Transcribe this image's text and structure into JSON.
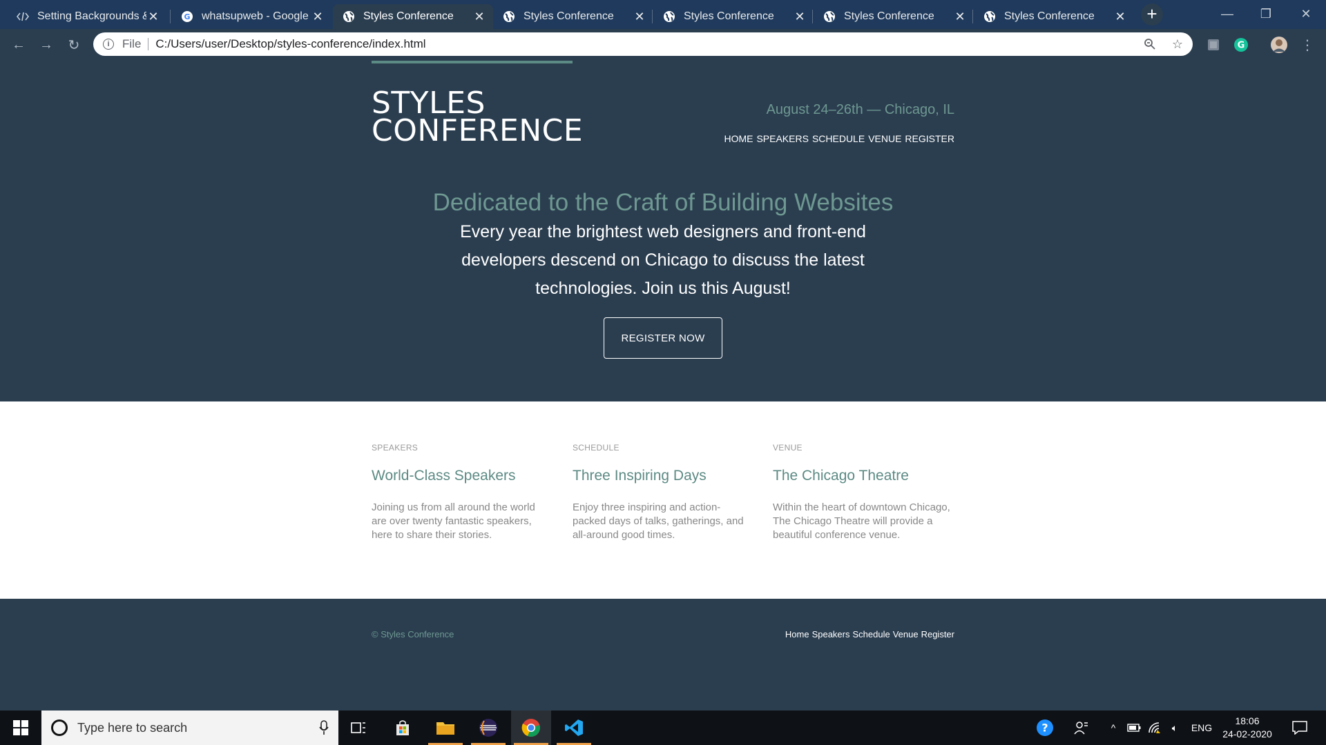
{
  "browser": {
    "tabs": [
      {
        "title": "Setting Backgrounds &",
        "icon": "code-icon",
        "active": false
      },
      {
        "title": "whatsupweb - Google S",
        "icon": "google-icon",
        "active": false
      },
      {
        "title": "Styles Conference",
        "icon": "globe-icon",
        "active": true
      },
      {
        "title": "Styles Conference",
        "icon": "globe-icon",
        "active": false
      },
      {
        "title": "Styles Conference",
        "icon": "globe-icon",
        "active": false
      },
      {
        "title": "Styles Conference",
        "icon": "globe-icon",
        "active": false
      },
      {
        "title": "Styles Conference",
        "icon": "globe-icon",
        "active": false
      }
    ],
    "address": {
      "scheme": "File",
      "url": "C:/Users/user/Desktop/styles-conference/index.html"
    }
  },
  "header": {
    "logo_line1": "STYLES",
    "logo_line2": "CONFERENCE",
    "dates": "August 24–26th — Chicago, IL",
    "nav": [
      "HOME",
      "SPEAKERS",
      "SCHEDULE",
      "VENUE",
      "REGISTER"
    ]
  },
  "hero": {
    "tagline": "Dedicated to the Craft of Building Websites",
    "lead": "Every year the brightest web designers and front-end developers descend on Chicago to discuss the latest technologies. Join us this August!",
    "cta": "REGISTER NOW"
  },
  "features": [
    {
      "kicker": "SPEAKERS",
      "title": "World-Class Speakers",
      "text": "Joining us from all around the world are over twenty fantastic speakers, here to share their stories."
    },
    {
      "kicker": "SCHEDULE",
      "title": "Three Inspiring Days",
      "text": "Enjoy three inspiring and action-packed days of talks, gatherings, and all-around good times."
    },
    {
      "kicker": "VENUE",
      "title": "The Chicago Theatre",
      "text": "Within the heart of downtown Chicago, The Chicago Theatre will provide a beautiful conference venue."
    }
  ],
  "footer": {
    "copyright": "© Styles Conference",
    "nav": [
      "Home",
      "Speakers",
      "Schedule",
      "Venue",
      "Register"
    ]
  },
  "taskbar": {
    "search_placeholder": "Type here to search",
    "language": "ENG",
    "time": "18:06",
    "date": "24-02-2020"
  },
  "colors": {
    "page_dark": "#2b3e50",
    "accent_teal": "#6e9891",
    "tab_strip": "#1f3a5c"
  }
}
